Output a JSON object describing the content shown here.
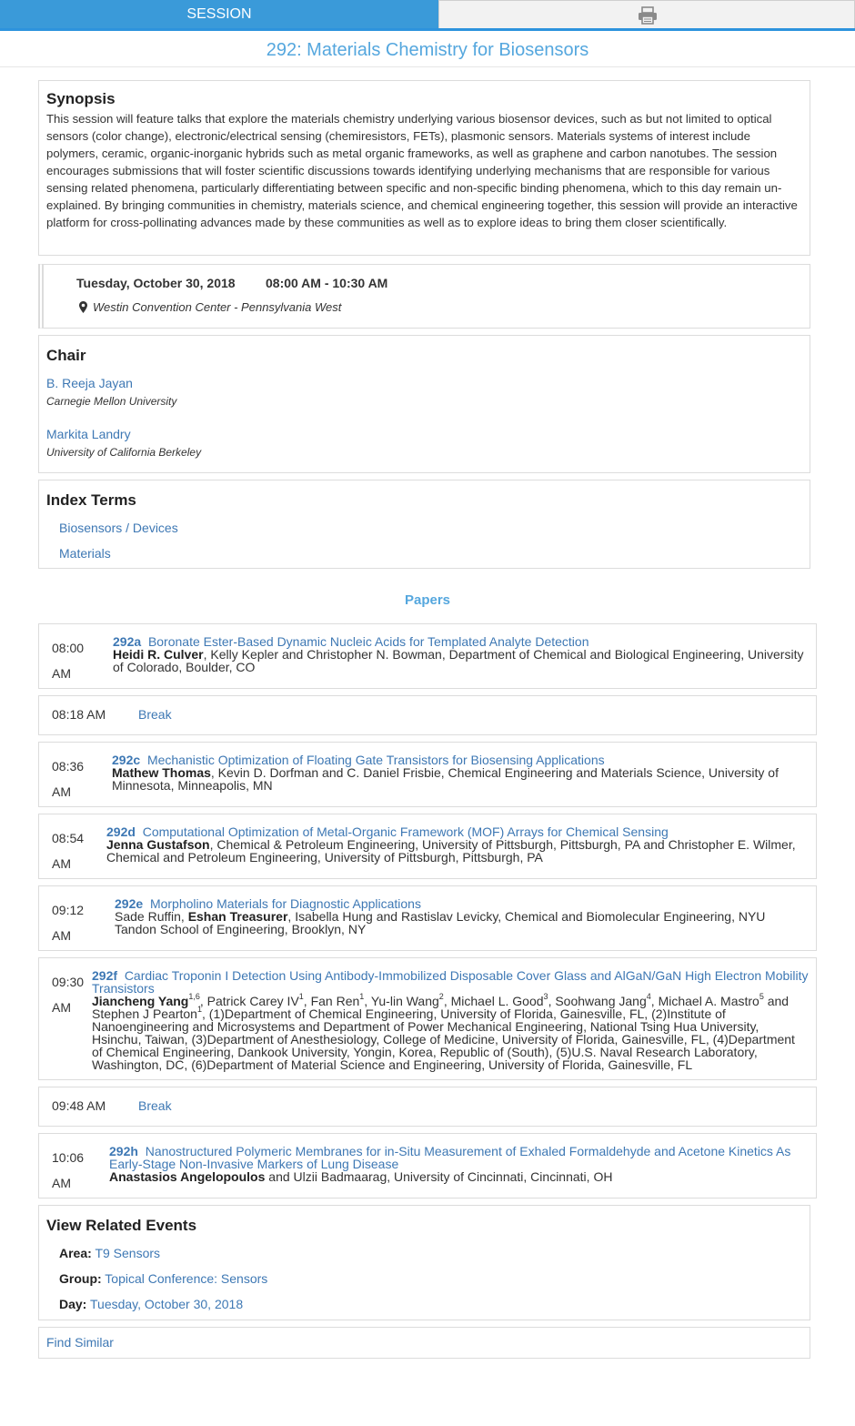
{
  "tabs": {
    "session_label": "SESSION",
    "print_icon": "printer-icon"
  },
  "session_title": "292: Materials Chemistry for Biosensors",
  "synopsis": {
    "heading": "Synopsis",
    "text": "This session will feature talks that explore the materials chemistry underlying various biosensor devices, such as but not limited to optical sensors (color change), electronic/electrical sensing (chemiresistors, FETs), plasmonic sensors. Materials systems of interest include polymers, ceramic, organic-inorganic hybrids such as metal organic frameworks, as well as graphene and carbon nanotubes. The session encourages submissions that will foster scientific discussions towards identifying underlying mechanisms that are responsible for various sensing related phenomena, particularly differentiating between specific and non-specific binding phenomena, which to this day remain un-explained. By bringing communities in chemistry, materials science, and chemical engineering together, this session will provide an interactive platform for cross-pollinating advances made by these communities as well as to explore ideas to bring them closer scientifically."
  },
  "schedule": {
    "date": "Tuesday, October 30, 2018",
    "time": "08:00 AM - 10:30 AM",
    "location": "Westin Convention Center - Pennsylvania West"
  },
  "chair": {
    "heading": "Chair",
    "people": [
      {
        "name": "B. Reeja Jayan",
        "affiliation": "Carnegie Mellon University"
      },
      {
        "name": "Markita Landry",
        "affiliation": "University of California Berkeley"
      }
    ]
  },
  "index_terms": {
    "heading": "Index Terms",
    "terms": [
      "Biosensors / Devices",
      "Materials"
    ]
  },
  "papers_heading": "Papers",
  "papers": [
    {
      "time": "08:00 AM",
      "id": "292a",
      "title": "Boronate Ester-Based Dynamic Nucleic Acids for Templated Analyte Detection",
      "presenter": "Heidi R. Culver",
      "rest": ", Kelly Kepler and Christopher N. Bowman, Department of Chemical and Biological Engineering, University of Colorado, Boulder, CO"
    },
    {
      "time": "08:18 AM",
      "break_label": "Break"
    },
    {
      "time": "08:36 AM",
      "id": "292c",
      "title": "Mechanistic Optimization of Floating Gate Transistors for Biosensing Applications",
      "presenter": "Mathew Thomas",
      "rest": ", Kevin D. Dorfman and C. Daniel Frisbie, Chemical Engineering and Materials Science, University of Minnesota, Minneapolis, MN"
    },
    {
      "time": "08:54 AM",
      "id": "292d",
      "title": "Computational Optimization of Metal-Organic Framework (MOF) Arrays for Chemical Sensing",
      "presenter": "Jenna Gustafson",
      "rest": ", Chemical & Petroleum Engineering, University of Pittsburgh, Pittsburgh, PA and Christopher E. Wilmer, Chemical and Petroleum Engineering, University of Pittsburgh, Pittsburgh, PA"
    },
    {
      "time": "09:12 AM",
      "id": "292e",
      "title": "Morpholino Materials for Diagnostic Applications",
      "pre": "Sade Ruffin, ",
      "presenter": "Eshan Treasurer",
      "rest": ", Isabella Hung and Rastislav Levicky, Chemical and Biomolecular Engineering, NYU Tandon School of Engineering, Brooklyn, NY"
    },
    {
      "time": "09:30 AM",
      "id": "292f",
      "title": "Cardiac Troponin I Detection Using Antibody-Immobilized Disposable Cover Glass and AlGaN/GaN High Electron Mobility Transistors",
      "presenter": "Jiancheng Yang",
      "sup_presenter": "1,6",
      "authors_list": [
        {
          "name": "Patrick Carey IV",
          "sup": "1"
        },
        {
          "name": "Fan Ren",
          "sup": "1"
        },
        {
          "name": "Yu-lin Wang",
          "sup": "2"
        },
        {
          "name": "Michael L. Good",
          "sup": "3"
        },
        {
          "name": "Soohwang Jang",
          "sup": "4"
        },
        {
          "name": "Michael A. Mastro",
          "sup": "5"
        }
      ],
      "last_author": "Stephen J Pearton",
      "last_sup": "1",
      "affiliations": "(1)Department of Chemical Engineering, University of Florida, Gainesville, FL, (2)Institute of Nanoengineering and Microsystems and Department of Power Mechanical Engineering, National Tsing Hua University, Hsinchu, Taiwan, (3)Department of Anesthesiology, College of Medicine, University of Florida, Gainesville, FL, (4)Department of Chemical Engineering, Dankook University, Yongin, Korea, Republic of (South), (5)U.S. Naval Research Laboratory, Washington, DC, (6)Department of Material Science and Engineering, University of Florida, Gainesville, FL"
    },
    {
      "time": "09:48 AM",
      "break_label": "Break"
    },
    {
      "time": "10:06 AM",
      "id": "292h",
      "title": "Nanostructured Polymeric Membranes for in-Situ Measurement of Exhaled Formaldehyde and Acetone Kinetics As Early-Stage Non-Invasive Markers of Lung Disease",
      "presenter": "Anastasios Angelopoulos",
      "rest": " and Ulzii Badmaarag, University of Cincinnati, Cincinnati, OH"
    }
  ],
  "related": {
    "heading": "View Related Events",
    "area_label": "Area:",
    "area_value": "T9 Sensors",
    "group_label": "Group:",
    "group_value": "Topical Conference: Sensors",
    "day_label": "Day:",
    "day_value": "Tuesday, October 30, 2018"
  },
  "find_similar": "Find Similar"
}
